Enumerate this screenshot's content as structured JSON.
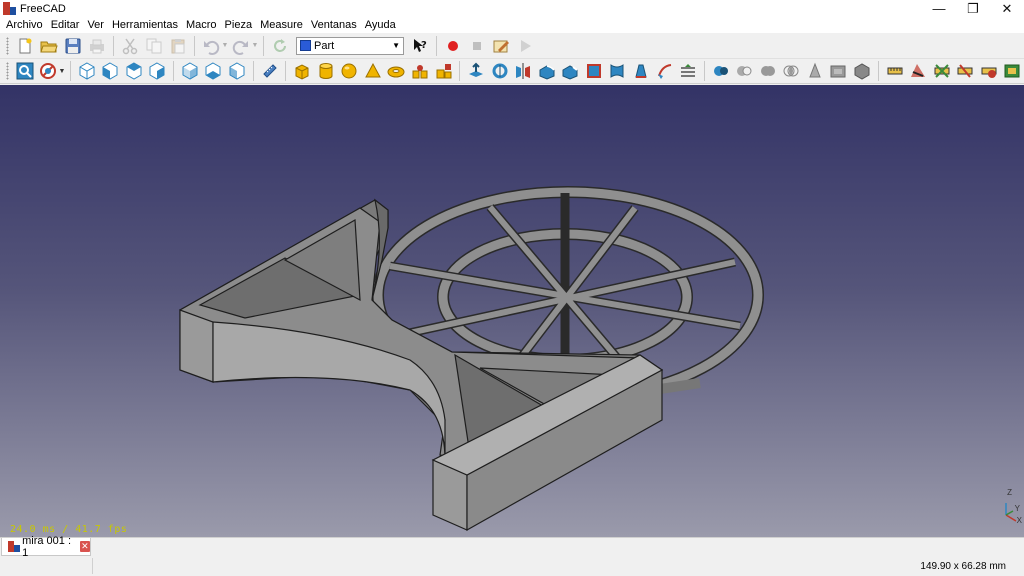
{
  "window": {
    "title": "FreeCAD",
    "controls": {
      "minimize": "—",
      "restore": "❐",
      "close": "✕"
    }
  },
  "menu": [
    "Archivo",
    "Editar",
    "Ver",
    "Herramientas",
    "Macro",
    "Pieza",
    "Measure",
    "Ventanas",
    "Ayuda"
  ],
  "toolbar_top": {
    "workbench": "Part",
    "icons": [
      "new-icon",
      "open-icon",
      "save-icon",
      "print-icon",
      "cut-icon",
      "copy-icon",
      "paste-icon",
      "undo-icon",
      "redo-icon",
      "refresh-icon",
      "whats-this-icon",
      "macro-record-icon",
      "macro-stop-icon",
      "macro-edit-icon",
      "macro-run-icon"
    ]
  },
  "toolbar_view": {
    "icons": [
      "fit-all-icon",
      "draw-style-icon",
      "isometric-view-icon",
      "front-view-icon",
      "top-view-icon",
      "right-view-icon",
      "rear-view-icon",
      "bottom-view-icon",
      "left-view-icon",
      "measure-distance-icon"
    ]
  },
  "toolbar_part": {
    "primitives": [
      "box-icon",
      "cylinder-icon",
      "sphere-icon",
      "cone-icon",
      "torus-icon",
      "tube-icon",
      "primitives-icon"
    ],
    "tools": [
      "extrude-icon",
      "revolve-icon",
      "mirror-icon",
      "fillet-icon",
      "chamfer-icon",
      "make-face-icon",
      "ruled-surface-icon",
      "loft-icon",
      "sweep-icon",
      "section-icon"
    ],
    "booleans": [
      "boolean-icon",
      "cut-boolean-icon",
      "union-icon",
      "common-icon",
      "check-geometry-icon",
      "defeaturing-icon",
      "shape-builder-icon"
    ],
    "measure": [
      "measure-linear-icon",
      "measure-angular-icon",
      "measure-refresh-icon",
      "measure-clear-icon",
      "measure-toggle-icon",
      "measure-3d-icon"
    ]
  },
  "viewport": {
    "fps_text": "24.0 ms / 41.7 fps",
    "axis_labels": {
      "z": "Z",
      "y": "Y",
      "x": "X"
    },
    "background_top": "#333366",
    "background_bottom": "#9a9aab",
    "model_color": "#8a8a8a"
  },
  "tabs": [
    {
      "label": "mira 001 : 1"
    }
  ],
  "status": {
    "dimensions": "149.90 x 66.28 mm"
  }
}
